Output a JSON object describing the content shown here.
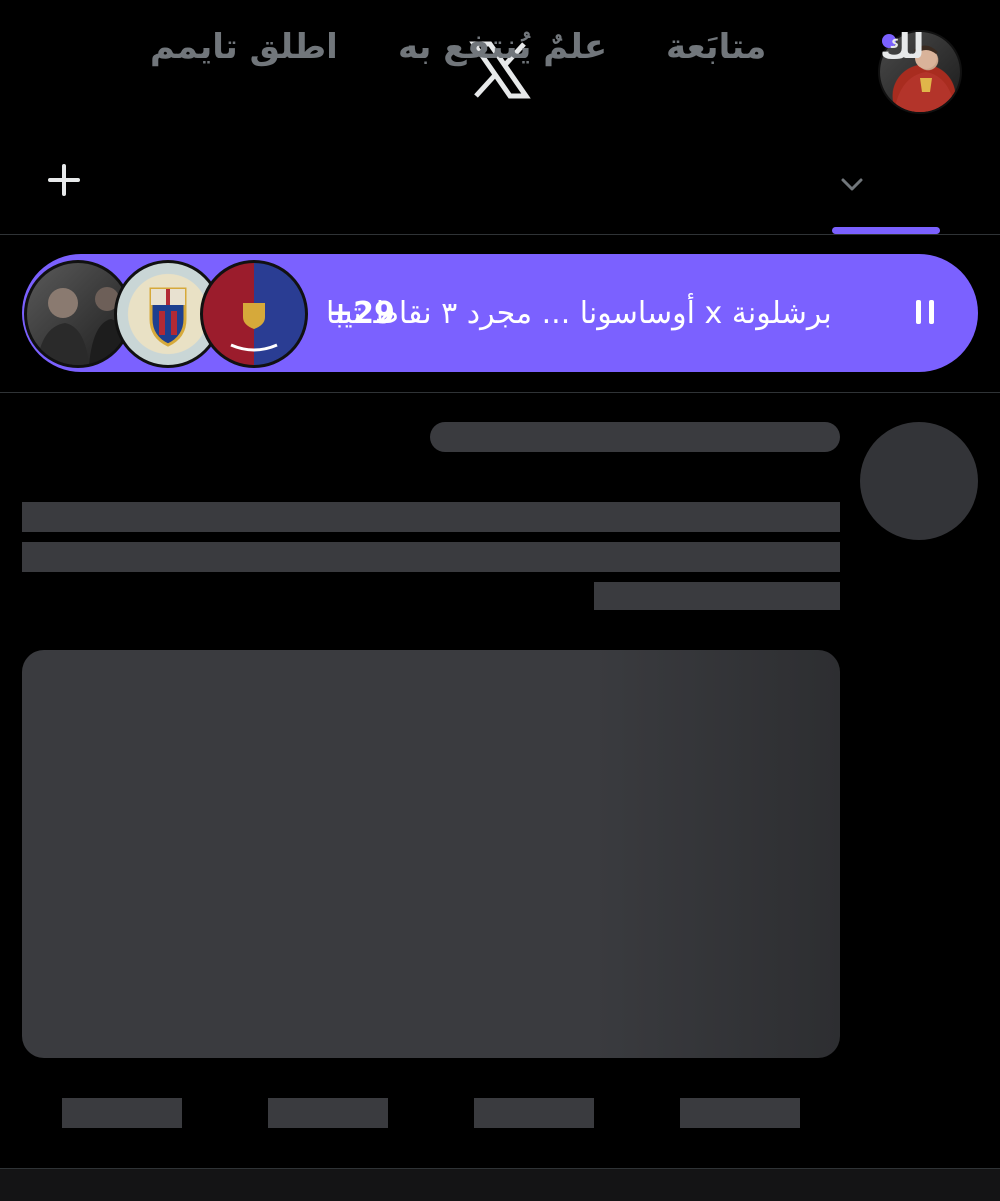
{
  "header": {
    "logo_icon": "x-logo-icon",
    "avatar_icon": "profile-avatar",
    "notification_dot_color": "#7b61ff"
  },
  "tabs": [
    {
      "label": "لك",
      "active": true
    },
    {
      "label": "متابَعة",
      "active": false
    },
    {
      "label": "علمٌ يُنتفع به",
      "active": false
    },
    {
      "label": "اطلق تايمم",
      "active": false
    }
  ],
  "tab_icons": {
    "dropdown": "chevron-down-icon",
    "add": "plus-icon"
  },
  "accent_color": "#7b61ff",
  "spaces_bar": {
    "title": "برشلونة x أوساسونا ... مجرد ٣ نقاط تيبا",
    "listener_count": "+29",
    "icon": "pause-icon"
  }
}
